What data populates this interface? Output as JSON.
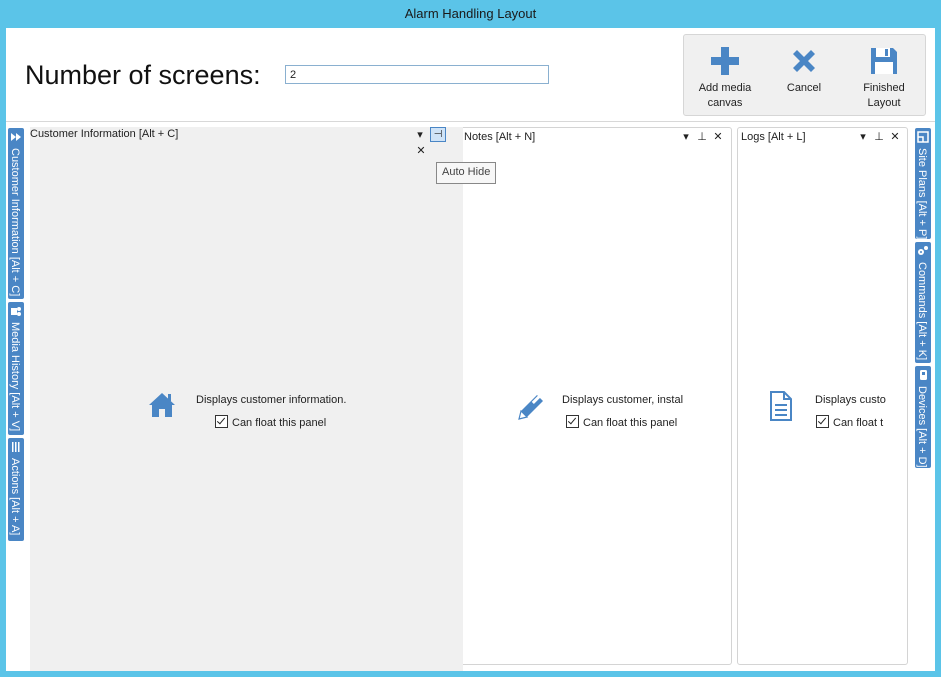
{
  "window": {
    "title": "Alarm Handling Layout"
  },
  "header": {
    "label": "Number of screens:",
    "screens_value": "2"
  },
  "toolbar": {
    "add_label_1": "Add media",
    "add_label_2": "canvas",
    "cancel_label": "Cancel",
    "finished_label_1": "Finished",
    "finished_label_2": "Layout"
  },
  "left_tabs": [
    {
      "label": "Customer Information [Alt + C]"
    },
    {
      "label": "Media History [Alt + V]"
    },
    {
      "label": "Actions [Alt + A]"
    }
  ],
  "right_tabs": [
    {
      "label": "Site Plans [Alt + P]"
    },
    {
      "label": "Commands [Alt + K]"
    },
    {
      "label": "Devices [Alt + D]"
    }
  ],
  "panels": {
    "customer": {
      "title": "Customer Information [Alt + C]",
      "description": "Displays customer information.",
      "checkbox_label": "Can float this panel",
      "tooltip": "Auto Hide"
    },
    "notes": {
      "title": "Notes [Alt + N]",
      "description": "Displays customer, instal",
      "checkbox_label": "Can float this panel"
    },
    "logs": {
      "title": "Logs [Alt + L]",
      "description": "Displays custo",
      "checkbox_label": "Can float t"
    }
  },
  "colors": {
    "accent": "#4a86c5",
    "frame": "#5bc4e8"
  }
}
